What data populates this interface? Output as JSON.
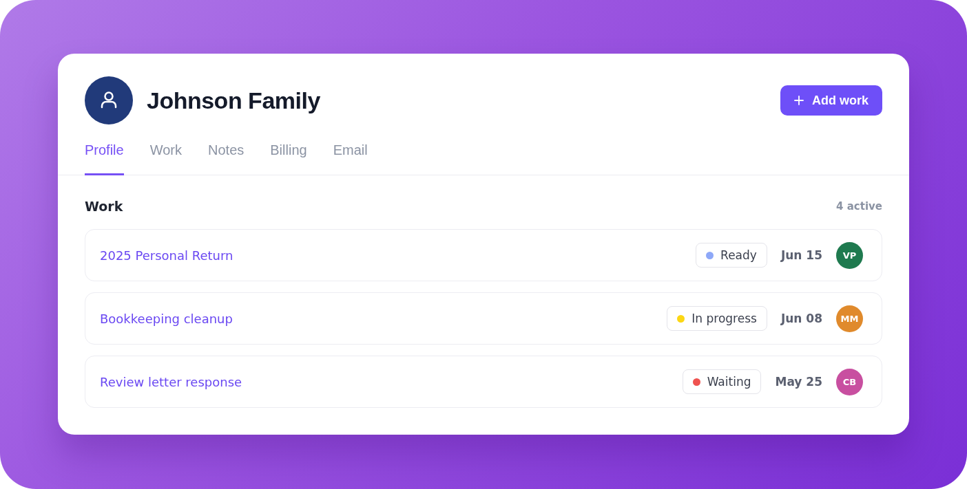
{
  "client": {
    "name": "Johnson Family"
  },
  "add_button": {
    "label": "Add work"
  },
  "tabs": [
    {
      "label": "Profile",
      "selected": true
    },
    {
      "label": "Work",
      "selected": false
    },
    {
      "label": "Notes",
      "selected": false
    },
    {
      "label": "Billing",
      "selected": false
    },
    {
      "label": "Email",
      "selected": false
    }
  ],
  "section": {
    "title": "Work",
    "count": "4 active"
  },
  "work_items": [
    {
      "title": "2025 Personal Return",
      "status": {
        "label": "Ready",
        "color": "#8ea8f8"
      },
      "date": "Jun 15",
      "assignee": {
        "initials": "VP",
        "color": "#1f7a4f"
      }
    },
    {
      "title": "Bookkeeping cleanup",
      "status": {
        "label": "In progress",
        "color": "#fcd714"
      },
      "date": "Jun 08",
      "assignee": {
        "initials": "MM",
        "color": "#e08a2c"
      }
    },
    {
      "title": "Review letter response",
      "status": {
        "label": "Waiting",
        "color": "#ef5350"
      },
      "date": "May 25",
      "assignee": {
        "initials": "CB",
        "color": "#c84fa0"
      }
    }
  ]
}
